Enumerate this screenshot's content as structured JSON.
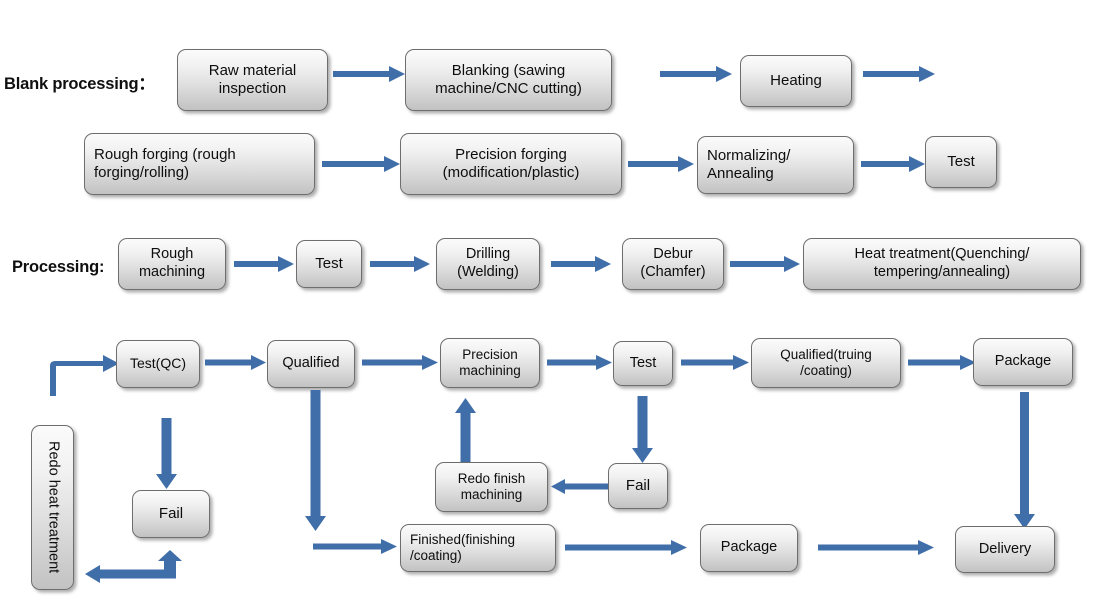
{
  "diagram": {
    "title": "Manufacturing process flowchart",
    "accent_color": "#3f6ea8",
    "box_border_color": "#6e6e6e",
    "text_color": "#0d0d0d"
  },
  "sections": [
    {
      "id": "blank",
      "label": "Blank processing："
    },
    {
      "id": "processing",
      "label": "Processing:"
    }
  ],
  "nodes": {
    "raw_material_inspection": "Raw material\ninspection",
    "raw_material_inspection_l1": "Raw material",
    "raw_material_inspection_l2": "inspection",
    "blanking_l1": "Blanking (sawing",
    "blanking_l2": "machine/CNC cutting)",
    "heating": "Heating",
    "rough_forging_l1": "Rough forging (rough",
    "rough_forging_l2": "forging/rolling)",
    "precision_forging_l1": "Precision forging",
    "precision_forging_l2": "(modification/plastic)",
    "normalizing_l1": "Normalizing/",
    "normalizing_l2": "Annealing",
    "test_blank": "Test",
    "rough_machining_l1": "Rough",
    "rough_machining_l2": "machining",
    "test_processing": "Test",
    "drilling_l1": "Drilling",
    "drilling_l2": "(Welding)",
    "debur_l1": "Debur",
    "debur_l2": "(Chamfer)",
    "heat_treatment_l1": "Heat treatment(Quenching/",
    "heat_treatment_l2": "tempering/annealing)",
    "test_qc": "Test(QC)",
    "qualified": "Qualified",
    "precision_machining_l1": "Precision",
    "precision_machining_l2": "machining",
    "test_qc2": "Test",
    "qualified_truing_l1": "Qualified(truing",
    "qualified_truing_l2": "/coating)",
    "package_top": "Package",
    "redo_heat_treatment": "Redo heat treatment",
    "fail_left": "Fail",
    "redo_finish_l1": "Redo finish",
    "redo_finish_l2": "machining",
    "fail_right": "Fail",
    "finished_l1": "Finished(finishing",
    "finished_l2": "/coating)",
    "package_bottom": "Package",
    "delivery": "Delivery"
  }
}
